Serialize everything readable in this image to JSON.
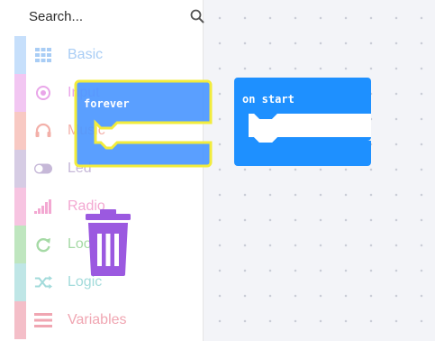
{
  "search": {
    "placeholder": "Search..."
  },
  "categories": [
    {
      "label": "Basic",
      "icon": "grid-icon",
      "color": "#1e90ff",
      "text_color": "#a9cdf5",
      "bar_color": "#c6dffb"
    },
    {
      "label": "Input",
      "icon": "target-icon",
      "color": "#d400d4",
      "text_color": "#e9a6e9",
      "bar_color": "#f2c6f2"
    },
    {
      "label": "Music",
      "icon": "headphones-icon",
      "color": "#e63022",
      "text_color": "#f3b0a9",
      "bar_color": "#f8c9c3"
    },
    {
      "label": "Led",
      "icon": "toggle-icon",
      "color": "#5c2d91",
      "text_color": "#c6b8d8",
      "bar_color": "#d6cce4"
    },
    {
      "label": "Radio",
      "icon": "signal-icon",
      "color": "#e3008c",
      "text_color": "#f3a8d2",
      "bar_color": "#f7c4e1"
    },
    {
      "label": "Loops",
      "icon": "refresh-icon",
      "color": "#00aa00",
      "text_color": "#a6daa6",
      "bar_color": "#bfe6bf"
    },
    {
      "label": "Logic",
      "icon": "shuffle-icon",
      "color": "#00a4a6",
      "text_color": "#a3dbdb",
      "bar_color": "#bfe6e6"
    },
    {
      "label": "Variables",
      "icon": "lines-icon",
      "color": "#dc143c",
      "text_color": "#f0a6b2",
      "bar_color": "#f4bec8"
    }
  ],
  "blocks": {
    "forever": {
      "label": "forever",
      "color": "#4c97ff",
      "outline": "#f2ec3c"
    },
    "on_start": {
      "label": "on start",
      "color": "#1e90ff"
    }
  },
  "trash": {
    "icon": "trash-icon",
    "color": "#9b59e0"
  }
}
